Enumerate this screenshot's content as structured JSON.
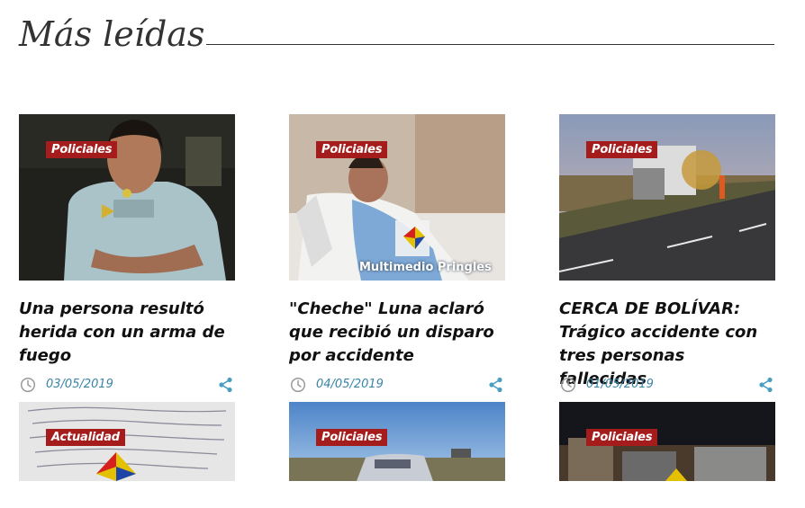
{
  "section": {
    "title": "Más leídas"
  },
  "articles": [
    {
      "category": "Policiales",
      "title": "Una persona resultó herida con un arma de fuego",
      "date": "03/05/2019"
    },
    {
      "category": "Policiales",
      "title": "\"Cheche\" Luna aclaró que recibió un disparo por accidente",
      "date": "04/05/2019",
      "watermark": "Multimedio Pringles"
    },
    {
      "category": "Policiales",
      "title": "CERCA DE BOLÍVAR: Trágico accidente con tres personas fallecidas",
      "date": "01/05/2019"
    },
    {
      "category": "Actualidad"
    },
    {
      "category": "Policiales"
    },
    {
      "category": "Policiales"
    }
  ],
  "icons": {
    "date": "clock-icon",
    "share": "share-icon"
  },
  "colors": {
    "tag_background": "#a51c1c",
    "date_text": "#3a84a8",
    "share_icon": "#4a9ec0",
    "heading_text": "#333333"
  }
}
